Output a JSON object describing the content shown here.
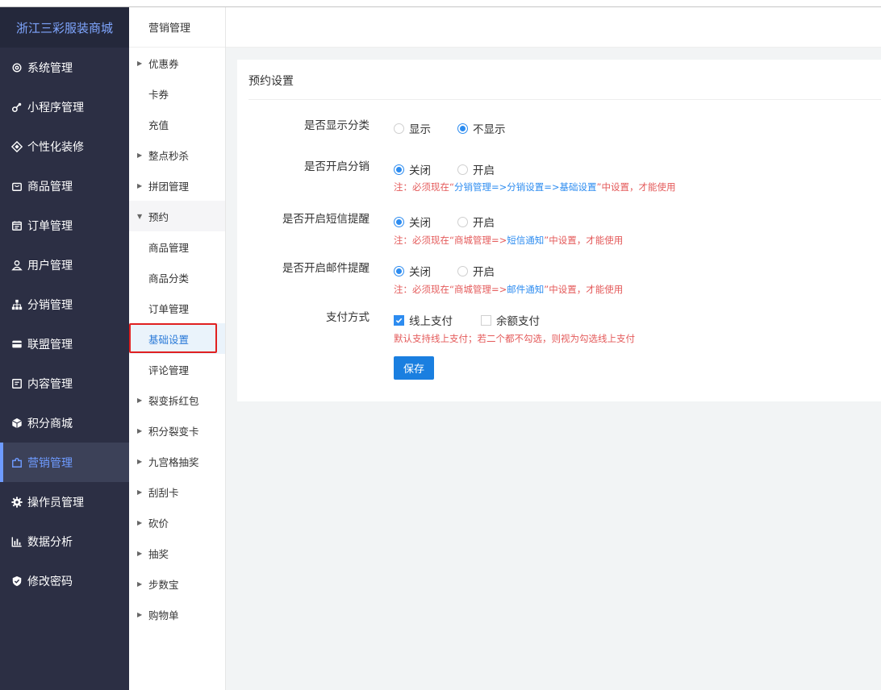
{
  "brand": "浙江三彩服装商城",
  "sidebar": {
    "items": [
      {
        "label": "系统管理",
        "icon": "gear-icon"
      },
      {
        "label": "小程序管理",
        "icon": "link-icon"
      },
      {
        "label": "个性化装修",
        "icon": "diamond-icon"
      },
      {
        "label": "商品管理",
        "icon": "bag-icon"
      },
      {
        "label": "订单管理",
        "icon": "calendar-icon"
      },
      {
        "label": "用户管理",
        "icon": "user-icon"
      },
      {
        "label": "分销管理",
        "icon": "network-icon"
      },
      {
        "label": "联盟管理",
        "icon": "wallet-icon"
      },
      {
        "label": "内容管理",
        "icon": "document-icon"
      },
      {
        "label": "积分商城",
        "icon": "cube-icon"
      },
      {
        "label": "营销管理",
        "icon": "puzzle-icon",
        "active": true
      },
      {
        "label": "操作员管理",
        "icon": "cog-icon"
      },
      {
        "label": "数据分析",
        "icon": "bar-chart-icon"
      },
      {
        "label": "修改密码",
        "icon": "shield-check-icon"
      }
    ]
  },
  "submenu": {
    "title": "营销管理",
    "items": [
      {
        "label": "优惠券"
      },
      {
        "label": "卡券"
      },
      {
        "label": "充值"
      },
      {
        "label": "整点秒杀"
      },
      {
        "label": "拼团管理"
      },
      {
        "label": "预约"
      },
      {
        "label": "商品管理"
      },
      {
        "label": "商品分类"
      },
      {
        "label": "订单管理"
      },
      {
        "label": "基础设置"
      },
      {
        "label": "评论管理"
      },
      {
        "label": "裂变拆红包"
      },
      {
        "label": "积分裂变卡"
      },
      {
        "label": "九宫格抽奖"
      },
      {
        "label": "刮刮卡"
      },
      {
        "label": "砍价"
      },
      {
        "label": "抽奖"
      },
      {
        "label": "步数宝"
      },
      {
        "label": "购物单"
      }
    ]
  },
  "form": {
    "title": "预约设置",
    "show_category": {
      "label": "是否显示分类",
      "opt1": "显示",
      "opt2": "不显示",
      "selected": "不显示"
    },
    "distribution": {
      "label": "是否开启分销",
      "opt1": "关闭",
      "opt2": "开启",
      "selected": "关闭",
      "note_pre": "注：必须现在“",
      "note_link1": "分销管理=>分销设置=>基础设置",
      "note_post": "”中设置，才能使用"
    },
    "sms": {
      "label": "是否开启短信提醒",
      "opt1": "关闭",
      "opt2": "开启",
      "selected": "关闭",
      "note_pre": "注：必须现在“商城管理=>",
      "note_link1": "短信通知",
      "note_post": "”中设置，才能使用"
    },
    "email": {
      "label": "是否开启邮件提醒",
      "opt1": "关闭",
      "opt2": "开启",
      "selected": "关闭",
      "note_pre": "注：必须现在“商城管理=>",
      "note_link1": "邮件通知",
      "note_post": "”中设置，才能使用"
    },
    "payment": {
      "label": "支付方式",
      "opt1": "线上支付",
      "opt2": "余额支付",
      "checked": [
        "线上支付"
      ],
      "note": "默认支持线上支付；若二个都不勾选，则视为勾选线上支付"
    },
    "save_label": "保存"
  },
  "colors": {
    "accent": "#2d8cf0",
    "note": "#e45a5a",
    "sidebar_bg": "#2c2f44",
    "highlight": "#e02020"
  }
}
